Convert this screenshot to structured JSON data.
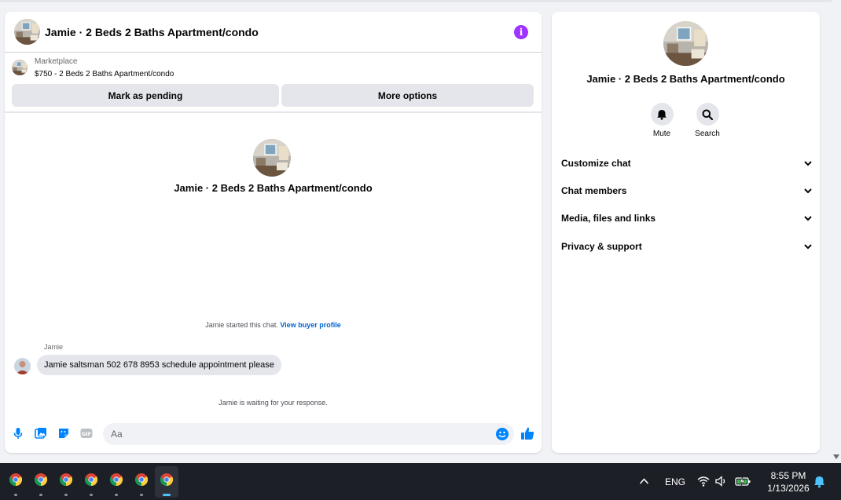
{
  "chat": {
    "title": "Jamie · 2 Beds 2 Baths Apartment/condo",
    "listing": {
      "kicker": "Marketplace",
      "price_line": "$750 - 2 Beds 2 Baths Apartment/condo"
    },
    "buttons": {
      "pending": "Mark as pending",
      "more": "More options"
    },
    "intro_title": "Jamie · 2 Beds 2 Baths Apartment/condo",
    "started_text": "Jamie started this chat.",
    "buyer_profile_link": "View buyer profile",
    "messages": [
      {
        "sender": "Jamie",
        "text": "Jamie saltsman 502 678 8953 schedule appointment please"
      }
    ],
    "waiting_text": "Jamie is waiting for your response.",
    "composer": {
      "placeholder": "Aa"
    },
    "icons": [
      "microphone-icon",
      "photo-icon",
      "sticker-icon",
      "gif-icon",
      "emoji-icon",
      "thumbs-up-icon",
      "info-icon"
    ]
  },
  "info_panel": {
    "title": "Jamie · 2 Beds 2 Baths Apartment/condo",
    "actions": [
      {
        "label": "Mute",
        "icon": "bell-icon"
      },
      {
        "label": "Search",
        "icon": "search-icon"
      }
    ],
    "sections": [
      "Customize chat",
      "Chat members",
      "Media, files and links",
      "Privacy & support"
    ]
  },
  "taskbar": {
    "apps": [
      "chrome",
      "chrome",
      "chrome",
      "chrome",
      "chrome",
      "chrome",
      "chrome"
    ],
    "language": "ENG",
    "time": "8:55 PM",
    "date": "1/13/2026"
  },
  "colors": {
    "accent_blue": "#0084ff",
    "link_blue": "#0064d1",
    "info_purple": "#a033ff",
    "taskbar_bg": "#1c2026"
  }
}
